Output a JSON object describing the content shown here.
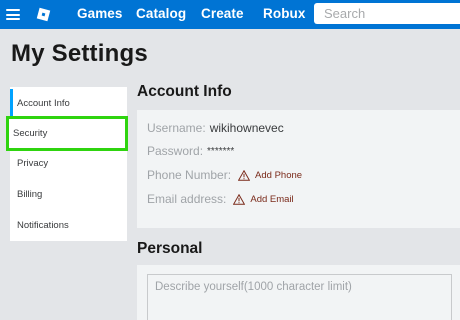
{
  "navbar": {
    "links": [
      "Games",
      "Catalog",
      "Create",
      "Robux"
    ],
    "search_placeholder": "Search",
    "background": "#0074d4"
  },
  "page": {
    "title": "My Settings"
  },
  "sidebar": {
    "items": [
      {
        "label": "Account Info",
        "state": "active"
      },
      {
        "label": "Security",
        "state": "highlighted"
      },
      {
        "label": "Privacy"
      },
      {
        "label": "Billing"
      },
      {
        "label": "Notifications"
      }
    ],
    "active_color": "#00a2ff",
    "highlight_color": "#2fd40f"
  },
  "account_info": {
    "title": "Account Info",
    "username_label": "Username:",
    "username_value": "wikihownevec",
    "password_label": "Password:",
    "password_value": "*******",
    "phone_label": "Phone Number:",
    "add_phone_label": "Add Phone",
    "email_label": "Email address:",
    "add_email_label": "Add Email",
    "warning_icon": "warning-triangle-icon"
  },
  "personal": {
    "title": "Personal",
    "description_placeholder": "Describe yourself(1000 character limit)"
  }
}
